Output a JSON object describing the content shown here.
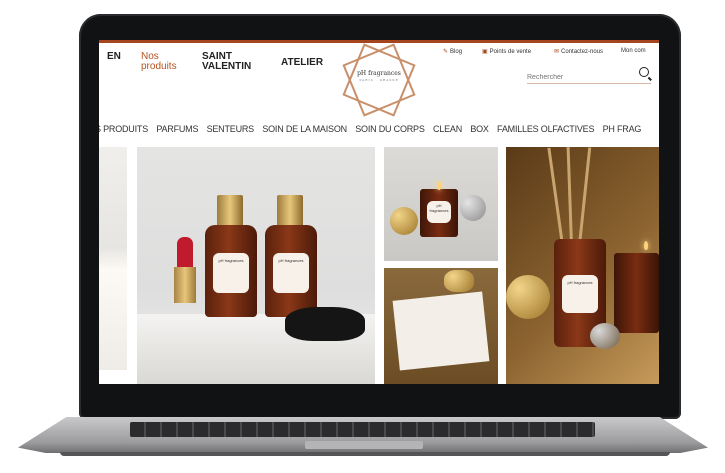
{
  "header": {
    "lang": "EN",
    "nav_nos": "Nos produits",
    "nav_saint": "SAINT VALENTIN",
    "nav_atelier": "ATELIER",
    "logo_text": "pH fragrances",
    "logo_sub": "PARIS · GRASSE",
    "utility": [
      "Blog",
      "Points de vente",
      "Contactez-nous",
      "Mon com"
    ],
    "search_placeholder": "Rechercher"
  },
  "categories": [
    "S PRODUITS",
    "PARFUMS",
    "SENTEURS",
    "SOIN DE LA MAISON",
    "SOIN DU CORPS",
    "CLEAN",
    "BOX",
    "FAMILLES OLFACTIVES",
    "PH FRAG"
  ],
  "products": {
    "bottle_label": "pH fragrances",
    "candle_label": "pH fragrances",
    "diffuser_label": "pH fragrances"
  },
  "colors": {
    "accent": "#a4451d",
    "nav_highlight": "#b5521f",
    "logo": "#c8906a"
  }
}
